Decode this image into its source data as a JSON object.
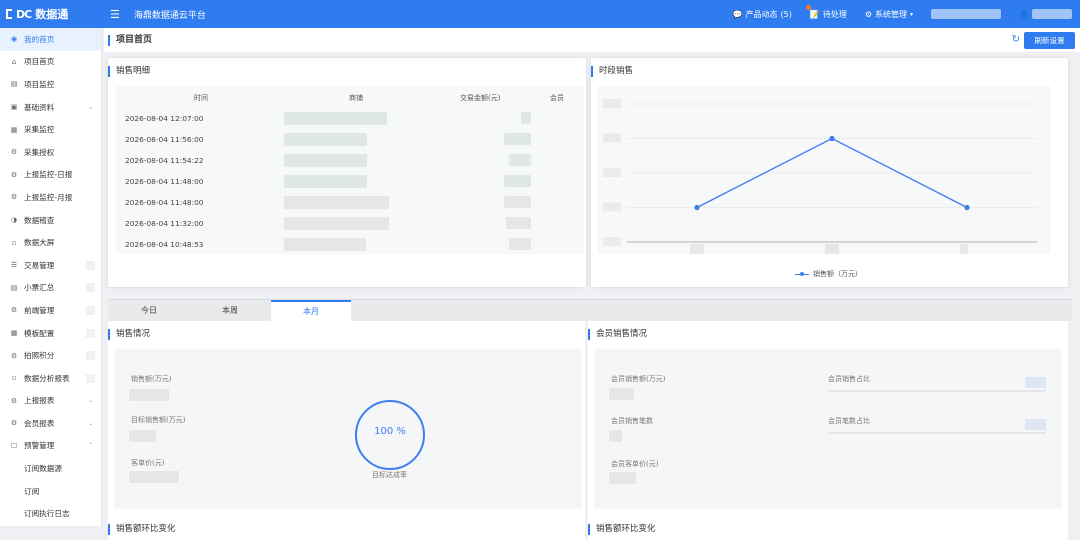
{
  "header": {
    "logo_mark": "DC",
    "logo_text": "数据通",
    "platform_title": "海鼎数据通云平台",
    "product_news": "产品动态",
    "product_news_count": "(5)",
    "todo": "待处理",
    "system_mgmt": "系统管理"
  },
  "sidebar": {
    "items": [
      {
        "label": "我的首页",
        "icon": "eye-icon"
      },
      {
        "label": "项目首页",
        "icon": "home-icon"
      },
      {
        "label": "项目监控",
        "icon": "monitor-icon"
      },
      {
        "label": "基础资料",
        "icon": "folder-icon"
      },
      {
        "label": "采集监控",
        "icon": "camera-icon"
      },
      {
        "label": "采集授权",
        "icon": "gear-icon"
      },
      {
        "label": "上报监控-日报",
        "icon": "gear-icon"
      },
      {
        "label": "上报监控-月报",
        "icon": "gear-icon"
      },
      {
        "label": "数据稽查",
        "icon": "circle-half-icon"
      },
      {
        "label": "数据大屏",
        "icon": "chart-icon"
      },
      {
        "label": "交易管理",
        "icon": "list-icon"
      },
      {
        "label": "小票汇总",
        "icon": "receipt-icon"
      },
      {
        "label": "前端管理",
        "icon": "gear-icon"
      },
      {
        "label": "模板配置",
        "icon": "template-icon"
      },
      {
        "label": "拍照积分",
        "icon": "gear-icon"
      },
      {
        "label": "数据分析报表",
        "icon": "chart-icon"
      },
      {
        "label": "上报报表",
        "icon": "gear-icon"
      },
      {
        "label": "会员报表",
        "icon": "gear-icon"
      },
      {
        "label": "预警管理",
        "icon": "bookmark-icon"
      }
    ],
    "sub_items": [
      "订阅数据源",
      "订阅",
      "订阅执行日志"
    ]
  },
  "page": {
    "title": "项目首页",
    "refresh_label": "刷新设置"
  },
  "sales_detail": {
    "title": "销售明细",
    "columns": [
      "时间",
      "商铺",
      "交易金额(元)",
      "会员"
    ],
    "rows": [
      {
        "time": "2026-08-04 12:07:00"
      },
      {
        "time": "2026-08-04 11:56:00"
      },
      {
        "time": "2026-08-04 11:54:22"
      },
      {
        "time": "2026-08-04 11:48:00"
      },
      {
        "time": "2026-08-04 11:48:00"
      },
      {
        "time": "2026-08-04 11:32:00"
      },
      {
        "time": "2026-08-04 10:48:53"
      }
    ]
  },
  "period_sales": {
    "title": "时段销售",
    "legend": "销售额（万元）"
  },
  "chart_data": {
    "type": "line",
    "title": "时段销售",
    "series": [
      {
        "name": "销售额（万元）",
        "values": [
          1,
          3,
          1
        ]
      }
    ],
    "x": [
      0,
      1,
      2
    ],
    "ylim": [
      0,
      4
    ],
    "grid": true,
    "legend": "bottom",
    "color": "#3d7ff0"
  },
  "tabs": [
    "今日",
    "本周",
    "本月"
  ],
  "active_tab": 2,
  "sales_status": {
    "title": "销售情况",
    "labels": [
      "销售额(万元)",
      "目标销售额(万元)",
      "客单价(元)"
    ],
    "progress": "100 %",
    "progress_value": 100,
    "progress_label": "目标达成率"
  },
  "member_sales": {
    "title": "会员销售情况",
    "labels_left": [
      "会员销售额(万元)",
      "会员销售笔数",
      "会员客单价(元)"
    ],
    "labels_right": [
      "会员销售占比",
      "会员笔数占比"
    ]
  },
  "bottom_titles": [
    "销售额环比变化",
    "销售额环比变化"
  ]
}
